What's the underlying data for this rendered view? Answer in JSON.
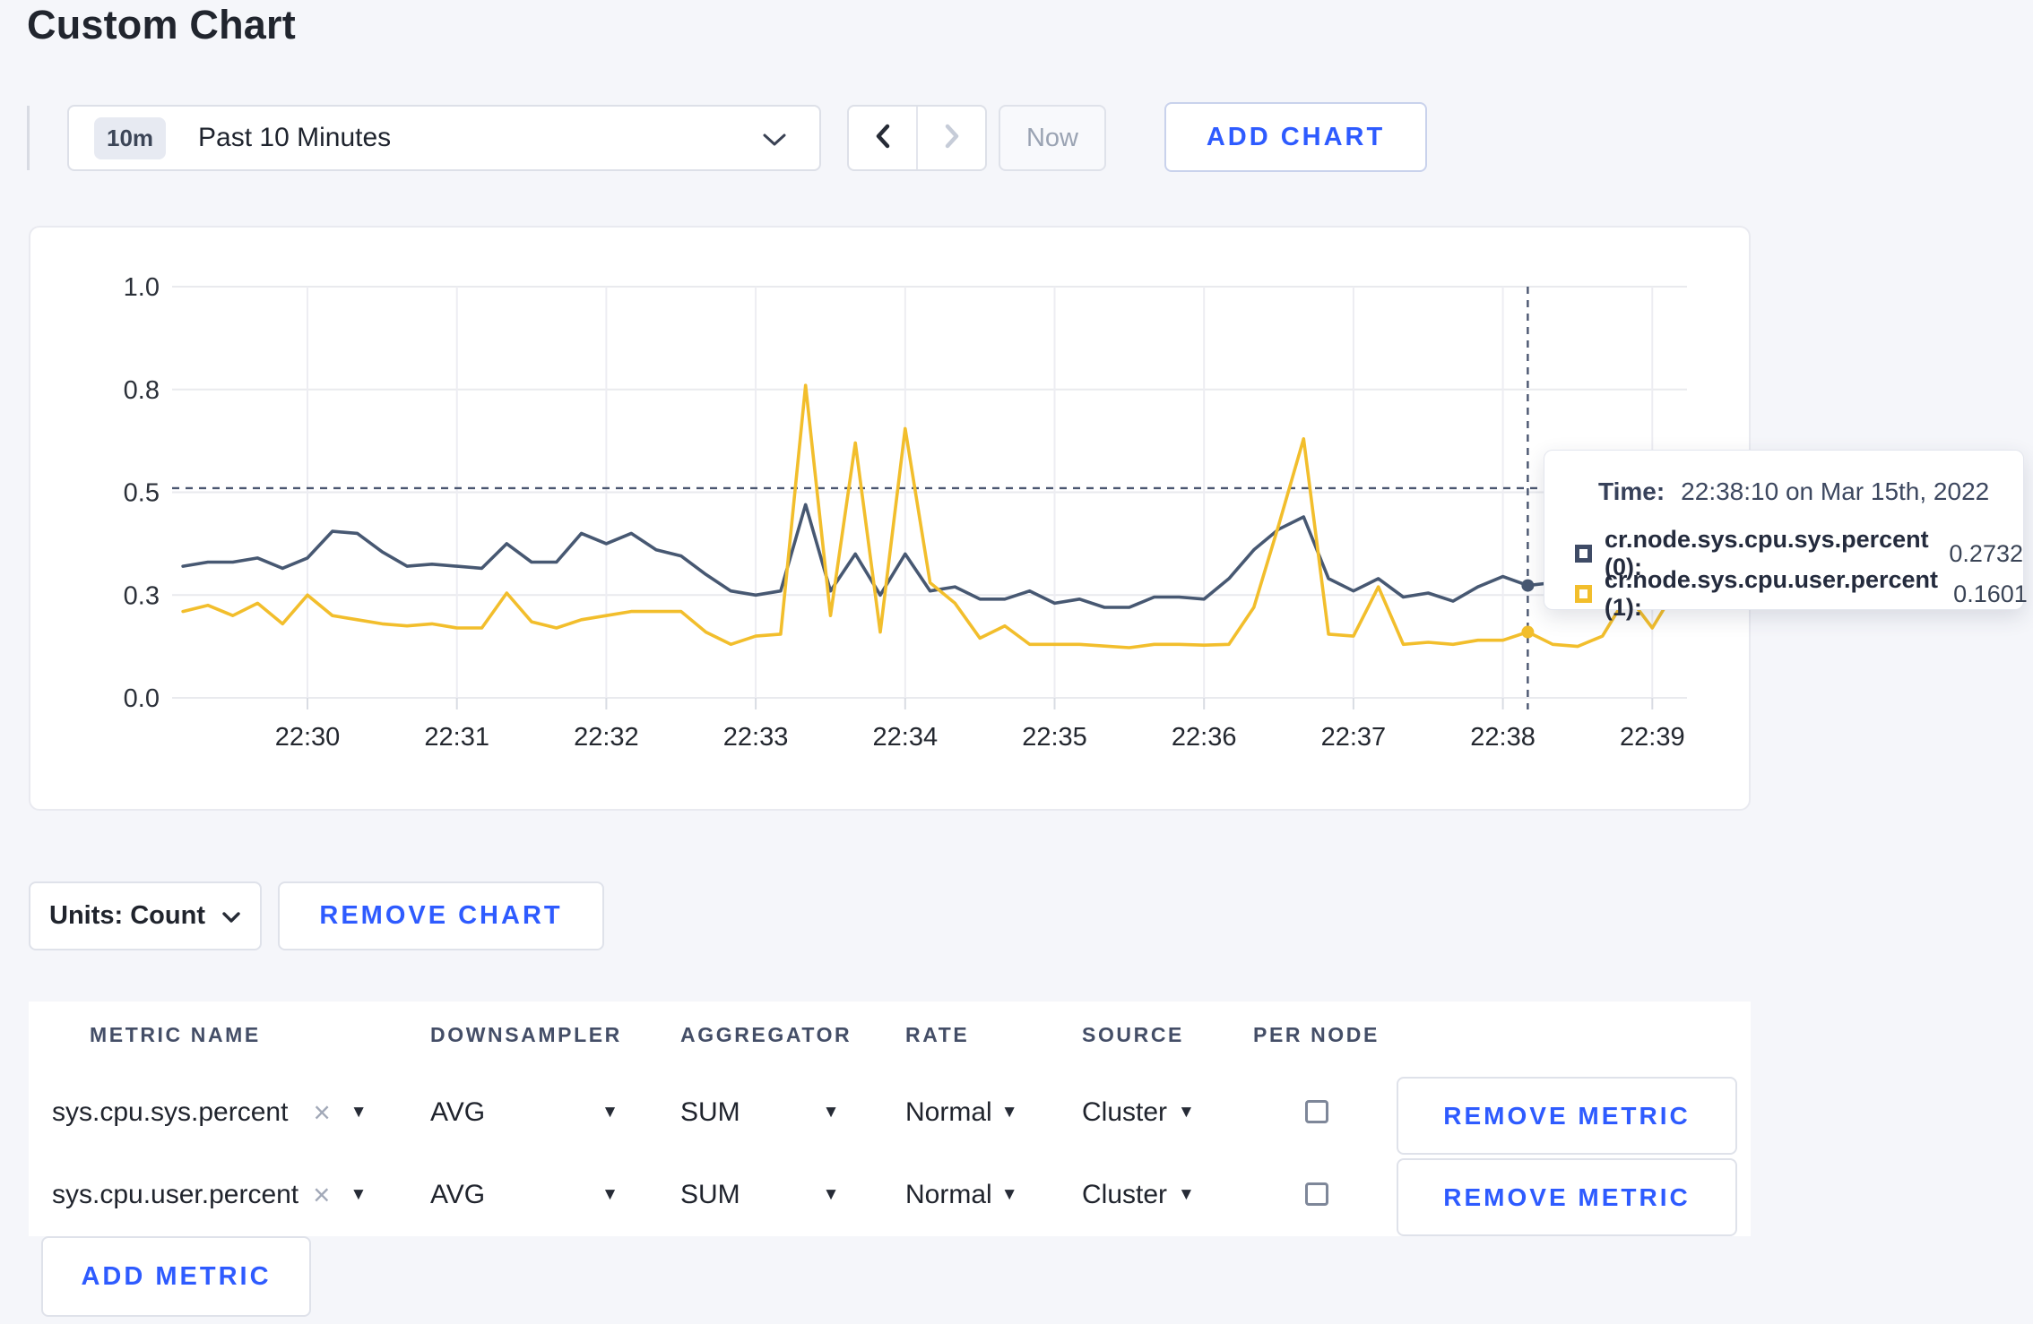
{
  "page": {
    "title": "Custom Chart",
    "background": "#f5f6fa",
    "accent_blue": "#2e5bff"
  },
  "toolbar": {
    "time_window_badge": "10m",
    "time_window_label": "Past 10 Minutes",
    "now_button": "Now",
    "add_chart_button": "ADD CHART",
    "icons": {
      "dropdown": "chevron-down-icon",
      "previous": "chevron-left-icon",
      "next": "chevron-right-icon"
    }
  },
  "chart_tooltip": {
    "time_label": "Time:",
    "time_value": "22:38:10 on Mar 15th, 2022",
    "series": [
      {
        "swatch_color": "#3f4b66",
        "name": "cr.node.sys.cpu.sys.percent (0):",
        "value": "0.2732"
      },
      {
        "swatch_color": "#f2be2c",
        "name": "cr.node.sys.cpu.user.percent (1):",
        "value": "0.1601"
      }
    ]
  },
  "chart_controls": {
    "units_button": "Units: Count",
    "remove_chart_button": "REMOVE CHART"
  },
  "metrics_table": {
    "headers": [
      "METRIC NAME",
      "DOWNSAMPLER",
      "AGGREGATOR",
      "RATE",
      "SOURCE",
      "PER NODE"
    ],
    "rows": [
      {
        "metric_name": "sys.cpu.sys.percent",
        "downsampler": "AVG",
        "aggregator": "SUM",
        "rate": "Normal",
        "source": "Cluster",
        "per_node_checked": false,
        "remove_button": "REMOVE METRIC"
      },
      {
        "metric_name": "sys.cpu.user.percent",
        "downsampler": "AVG",
        "aggregator": "SUM",
        "rate": "Normal",
        "source": "Cluster",
        "per_node_checked": false,
        "remove_button": "REMOVE METRIC"
      }
    ],
    "add_metric_button": "ADD METRIC"
  },
  "chart_data": {
    "type": "line",
    "title": "",
    "xlabel": "",
    "ylabel": "",
    "ylim": [
      0,
      1
    ],
    "grid": true,
    "legend_position": "none",
    "x_start": "22:29:10",
    "x_step_seconds": 10,
    "x_tick_labels": [
      "22:30",
      "22:31",
      "22:32",
      "22:33",
      "22:34",
      "22:35",
      "22:36",
      "22:37",
      "22:38",
      "22:39"
    ],
    "y_ticks": [
      {
        "value": 0.0,
        "label": "0.0"
      },
      {
        "value": 0.25,
        "label": "0.3"
      },
      {
        "value": 0.5,
        "label": "0.5"
      },
      {
        "value": 0.75,
        "label": "0.8"
      },
      {
        "value": 1.0,
        "label": "1.0"
      }
    ],
    "series": [
      {
        "name": "cr.node.sys.cpu.sys.percent",
        "color": "#475872",
        "values": [
          0.32,
          0.33,
          0.33,
          0.34,
          0.315,
          0.34,
          0.405,
          0.4,
          0.355,
          0.32,
          0.325,
          0.32,
          0.315,
          0.375,
          0.33,
          0.33,
          0.4,
          0.375,
          0.4,
          0.36,
          0.345,
          0.3,
          0.26,
          0.25,
          0.26,
          0.47,
          0.26,
          0.35,
          0.25,
          0.35,
          0.26,
          0.27,
          0.24,
          0.24,
          0.26,
          0.23,
          0.24,
          0.22,
          0.22,
          0.245,
          0.245,
          0.24,
          0.29,
          0.36,
          0.41,
          0.44,
          0.29,
          0.26,
          0.29,
          0.245,
          0.255,
          0.235,
          0.27,
          0.295,
          0.2732,
          0.28,
          0.27,
          0.28,
          0.27,
          0.27,
          0.27
        ]
      },
      {
        "name": "cr.node.sys.cpu.user.percent",
        "color": "#f2be2c",
        "values": [
          0.21,
          0.225,
          0.2,
          0.23,
          0.18,
          0.25,
          0.2,
          0.19,
          0.18,
          0.175,
          0.18,
          0.17,
          0.17,
          0.255,
          0.185,
          0.17,
          0.19,
          0.2,
          0.21,
          0.21,
          0.21,
          0.16,
          0.13,
          0.15,
          0.155,
          0.76,
          0.2,
          0.62,
          0.16,
          0.655,
          0.28,
          0.23,
          0.145,
          0.175,
          0.13,
          0.13,
          0.13,
          0.126,
          0.122,
          0.13,
          0.13,
          0.128,
          0.13,
          0.22,
          0.42,
          0.63,
          0.155,
          0.15,
          0.27,
          0.13,
          0.135,
          0.13,
          0.14,
          0.14,
          0.1601,
          0.13,
          0.125,
          0.15,
          0.25,
          0.17,
          0.27
        ]
      }
    ],
    "crosshair": {
      "time": "22:38:10",
      "x_offset_seconds": 540,
      "hline_value": 0.51,
      "points": [
        {
          "series": 0,
          "value": 0.2732
        },
        {
          "series": 1,
          "value": 0.1601
        }
      ]
    }
  }
}
